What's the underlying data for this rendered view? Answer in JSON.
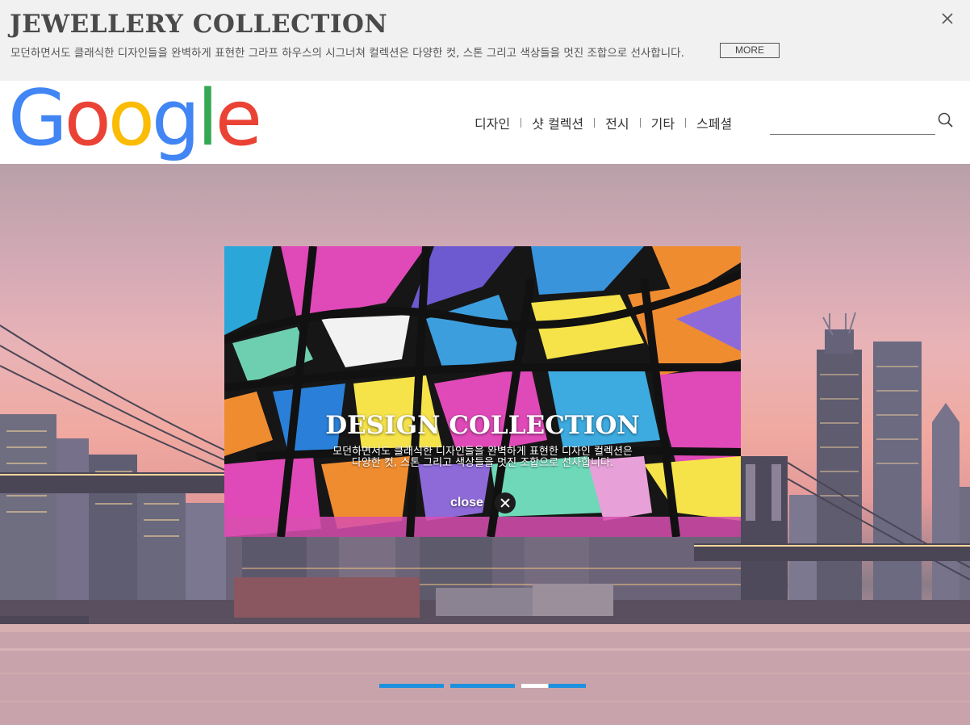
{
  "promo": {
    "title": "JEWELLERY COLLECTION",
    "text": "모던하면서도 클래식한 디자인들을 완벽하게 표현한 그라프 하우스의 시그너쳐 컬렉션은 다양한 컷, 스톤 그리고 색상들을 멋진 조합으로 선사합니다.",
    "more_label": "MORE",
    "close_icon": "close-icon"
  },
  "header": {
    "logo": "Google",
    "logo_colors": [
      "#4285F4",
      "#EA4335",
      "#FBBC05",
      "#4285F4",
      "#34A853",
      "#EA4335"
    ],
    "nav": [
      {
        "label": "디자인"
      },
      {
        "label": "샷 컬렉션"
      },
      {
        "label": "전시"
      },
      {
        "label": "기타"
      },
      {
        "label": "스페셜"
      }
    ],
    "search_placeholder": "",
    "search_icon": "search-icon"
  },
  "hero": {
    "background": "city-skyline-with-bridge",
    "pager": {
      "count": 3,
      "active_index": 2
    }
  },
  "modal": {
    "title": "DESIGN COLLECTION",
    "desc_line1": "모던하면서도 클래식한 디자인들을 완벽하게 표현한 디자인 컬렉션은",
    "desc_line2": "다양한 컷, 스톤 그리고 색상들을 멋진 조합으로 선사합니다.",
    "close_label": "close",
    "close_icon": "close-circle-icon",
    "background": "colorful-graffiti"
  }
}
